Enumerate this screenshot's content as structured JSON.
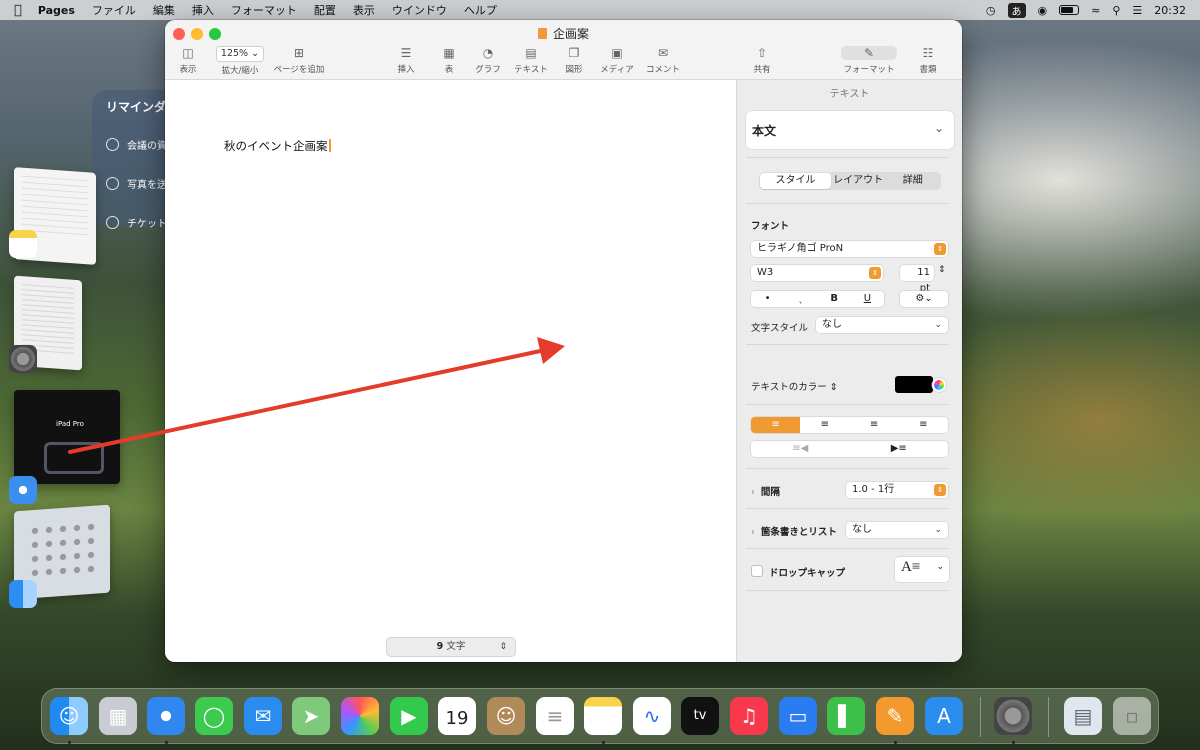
{
  "menubar": {
    "app": "Pages",
    "items": [
      "ファイル",
      "編集",
      "挿入",
      "フォーマット",
      "配置",
      "表示",
      "ウインドウ",
      "ヘルプ"
    ],
    "input_mode": "あ",
    "clock": "20:32"
  },
  "reminders": {
    "title": "リマインダー",
    "items": [
      "会議の資",
      "写真を送",
      "チケット"
    ]
  },
  "window": {
    "title": "企画案",
    "toolbar": {
      "view": "表示",
      "zoom_value": "125%",
      "zoom": "拡大/縮小",
      "add_page": "ページを追加",
      "insert": "挿入",
      "table": "表",
      "chart": "グラフ",
      "text": "テキスト",
      "shape": "図形",
      "media": "メディア",
      "comment": "コメント",
      "share": "共有",
      "format": "フォーマット",
      "document": "書類"
    },
    "body_text": "秋のイベント企画案",
    "word_count_number": "9",
    "word_count_label": "文字"
  },
  "inspector": {
    "header": "テキスト",
    "paragraph_style": "本文",
    "tabs": [
      "スタイル",
      "レイアウト",
      "詳細"
    ],
    "font_label": "フォント",
    "font_family": "ヒラギノ角ゴ ProN",
    "font_weight": "W3",
    "font_size": "11 pt",
    "style_buttons": [
      "•",
      "ˎ",
      "B",
      "U"
    ],
    "char_style_label": "文字スタイル",
    "char_style_value": "なし",
    "text_color_label": "テキストのカラー",
    "spacing_label": "間隔",
    "spacing_value": "1.0 - 1行",
    "bullets_label": "箇条書きとリスト",
    "bullets_value": "なし",
    "dropcap_label": "ドロップキャップ"
  },
  "colors": {
    "accent": "#f09a33",
    "arrow": "#e43b2b"
  }
}
